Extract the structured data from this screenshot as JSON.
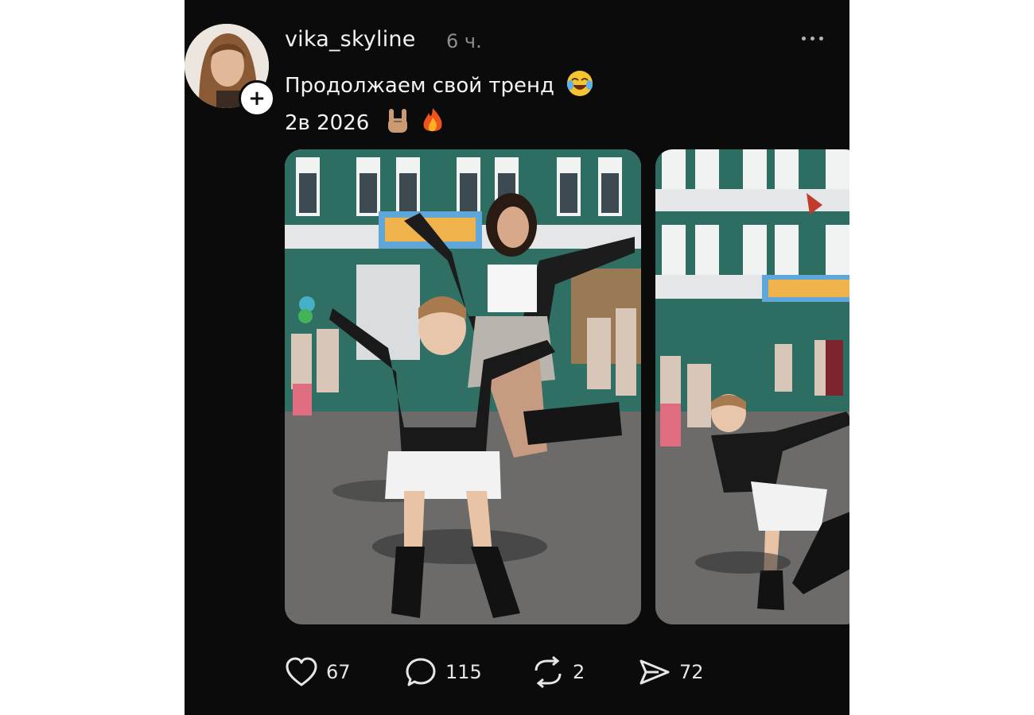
{
  "post": {
    "username": "vika_skyline",
    "time": "6 ч.",
    "caption_line1": "Продолжаем свой тренд",
    "caption_line2": "2в 2026",
    "emoji": [
      "face-with-tears-of-joy",
      "sign-of-horns",
      "fire"
    ]
  },
  "actions": {
    "likes": "67",
    "comments": "115",
    "reposts": "2",
    "shares": "72"
  },
  "colors": {
    "background": "#0b0b0b",
    "text": "#f2f2f2",
    "muted": "#8d8d8d"
  },
  "icons": {
    "more": "more-dots-icon",
    "follow": "plus-icon",
    "like": "heart-icon",
    "comment": "speech-bubble-icon",
    "repost": "repost-icon",
    "share": "paper-plane-icon"
  }
}
